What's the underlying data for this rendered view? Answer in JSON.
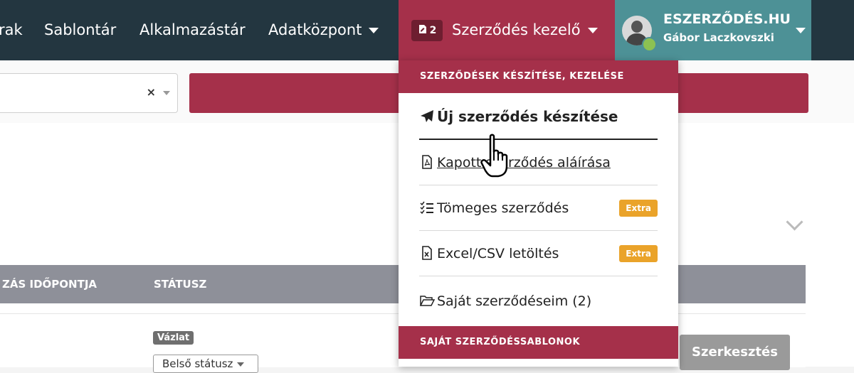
{
  "nav": {
    "items": [
      "rak",
      "Sablontár",
      "Alkalmazástár",
      "Adatközpont"
    ],
    "szerzodes": {
      "badge": "2",
      "label": "Szerződés kezelő"
    },
    "user": {
      "brand": "ESZERZŐDÉS.HU",
      "name": "Gábor Laczkovszki"
    }
  },
  "search": {
    "clear": "×"
  },
  "table": {
    "headers": [
      "ZÁS IDŐPONTJA",
      "STÁTUSZ"
    ]
  },
  "row": {
    "status_badge": "Vázlat",
    "internal_status": "Belső státusz",
    "edit_button": "Szerkesztés"
  },
  "dropdown": {
    "section1": "SZERZŐDÉSEK KÉSZÍTÉSE, KEZELÉSE",
    "items": [
      {
        "label": "Új szerződés készítése",
        "icon": "paper-plane-icon"
      },
      {
        "label": "Kapott szerződés aláírása",
        "icon": "pdf-file-icon"
      },
      {
        "label": "Tömeges szerződés",
        "icon": "checklist-icon",
        "badge": "Extra"
      },
      {
        "label": "Excel/CSV letöltés",
        "icon": "excel-file-icon",
        "badge": "Extra"
      },
      {
        "label": "Saját szerződéseim (2)",
        "icon": "folder-open-icon"
      }
    ],
    "section2": "SAJÁT SZERZŐDÉSSABLONOK"
  },
  "colors": {
    "nav": "#233640",
    "accent": "#a5304a",
    "user": "#4d9196",
    "extra": "#eaa32a",
    "header_row": "#8e9099"
  }
}
